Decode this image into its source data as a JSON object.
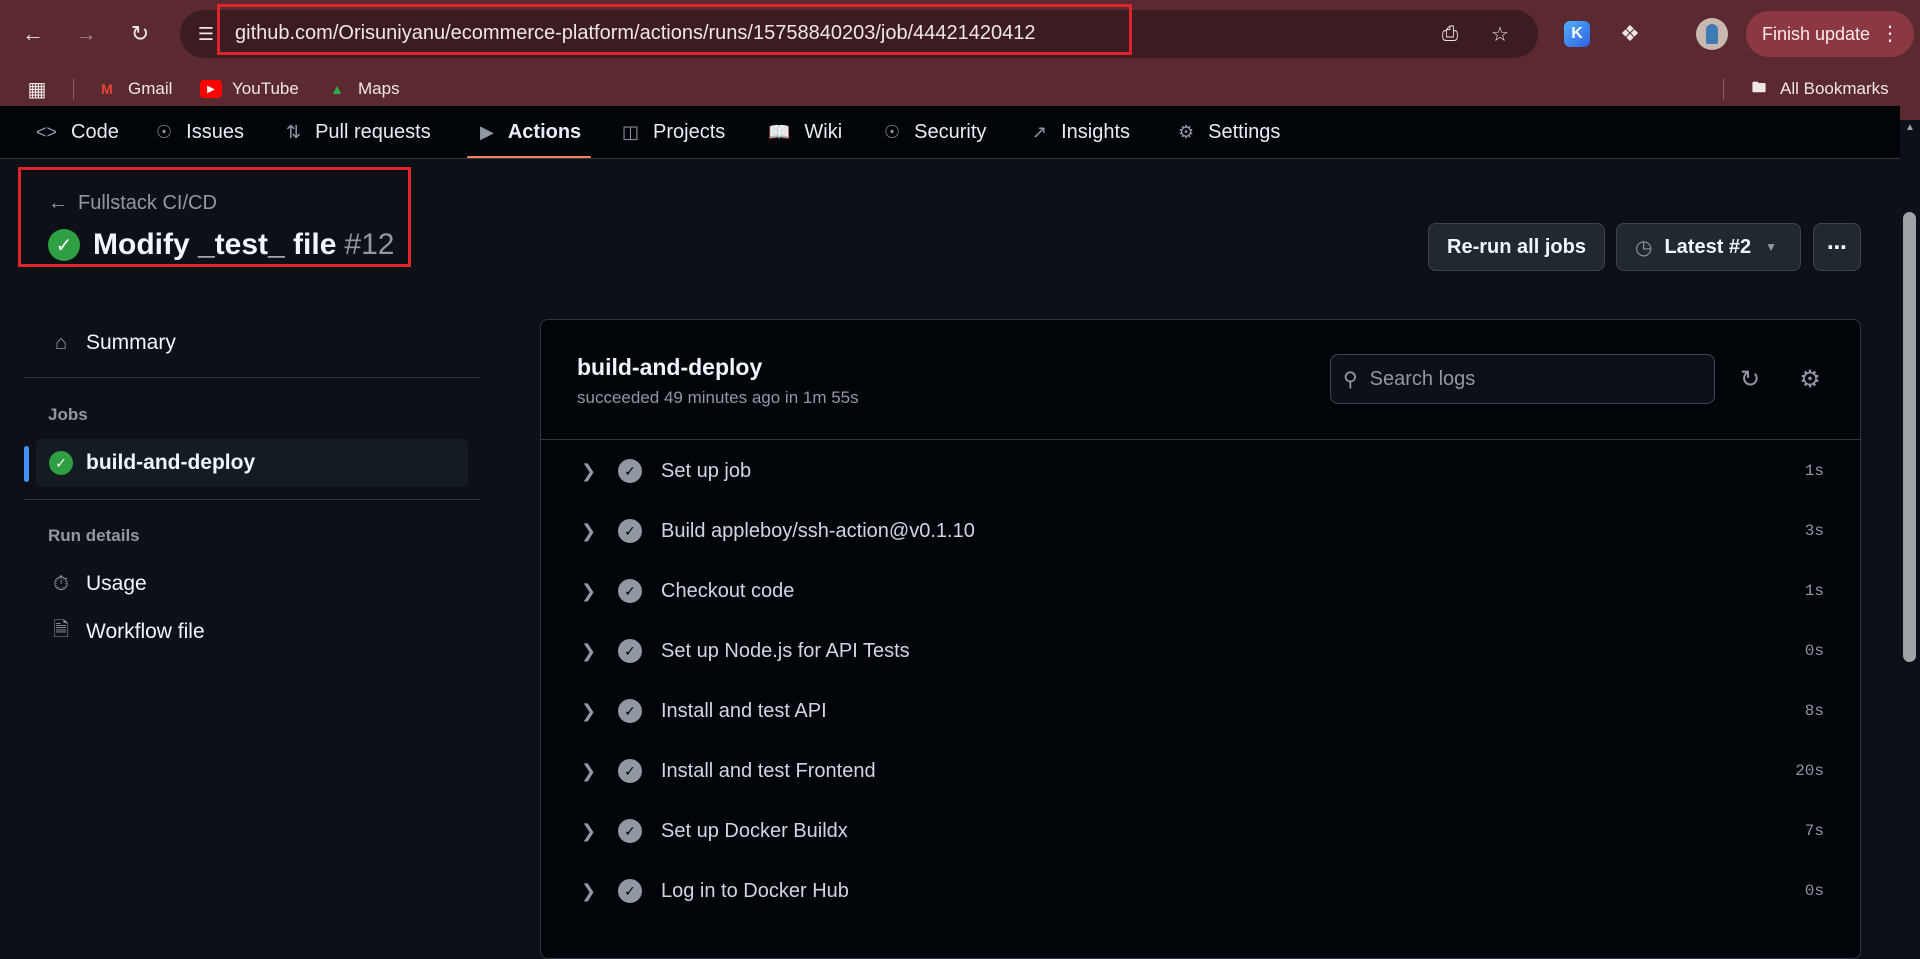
{
  "browser": {
    "url": "github.com/Orisuniyanu/ecommerce-platform/actions/runs/15758840203/job/44421420412",
    "finish_update": "Finish update",
    "bookmarks": [
      {
        "label": "Gmail"
      },
      {
        "label": "YouTube"
      },
      {
        "label": "Maps"
      }
    ],
    "all_bookmarks": "All Bookmarks",
    "extension_letter": "K"
  },
  "repo_nav": {
    "tabs": [
      {
        "label": "Code",
        "icon": "code-icon"
      },
      {
        "label": "Issues",
        "icon": "issue-icon"
      },
      {
        "label": "Pull requests",
        "icon": "pull-request-icon"
      },
      {
        "label": "Actions",
        "icon": "play-icon"
      },
      {
        "label": "Projects",
        "icon": "table-icon"
      },
      {
        "label": "Wiki",
        "icon": "book-icon"
      },
      {
        "label": "Security",
        "icon": "shield-icon"
      },
      {
        "label": "Insights",
        "icon": "graph-icon"
      },
      {
        "label": "Settings",
        "icon": "gear-icon"
      }
    ],
    "active": "Actions"
  },
  "header": {
    "back_label": "Fullstack CI/CD",
    "run_title": "Modify _test_ file",
    "run_number": "#12",
    "rerun_label": "Re-run all jobs",
    "attempt_label": "Latest #2"
  },
  "sidebar": {
    "summary": "Summary",
    "jobs_heading": "Jobs",
    "job": "build-and-deploy",
    "run_details_heading": "Run details",
    "usage": "Usage",
    "workflow_file": "Workflow file"
  },
  "job": {
    "name": "build-and-deploy",
    "status": "succeeded 49 minutes ago in 1m 55s",
    "search_placeholder": "Search logs",
    "steps": [
      {
        "label": "Set up job",
        "duration": "1s"
      },
      {
        "label": "Build appleboy/ssh-action@v0.1.10",
        "duration": "3s"
      },
      {
        "label": "Checkout code",
        "duration": "1s"
      },
      {
        "label": "Set up Node.js for API Tests",
        "duration": "0s"
      },
      {
        "label": "Install and test API",
        "duration": "8s"
      },
      {
        "label": "Install and test Frontend",
        "duration": "20s"
      },
      {
        "label": "Set up Docker Buildx",
        "duration": "7s"
      },
      {
        "label": "Log in to Docker Hub",
        "duration": "0s"
      }
    ]
  },
  "colors": {
    "chrome_bg": "#5a2a30",
    "page_bg": "#0d1117",
    "success": "#2ea043",
    "active_tab_underline": "#f78166",
    "highlight_box": "#e0242b"
  }
}
